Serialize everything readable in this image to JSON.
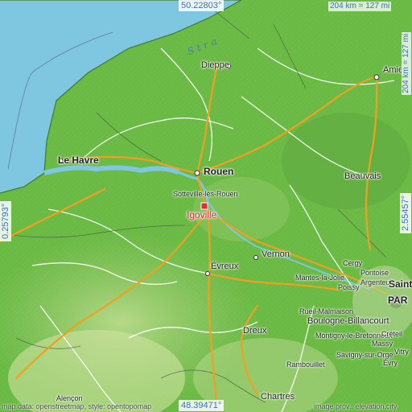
{
  "coordinates": {
    "top": "50.22803°",
    "bottom": "48.39471°",
    "left": "0.25793°",
    "right": "2.55457°"
  },
  "scale": {
    "top": "204 km = 127 mi",
    "right": "204 km = 127 mi"
  },
  "water_label": "Stra",
  "highlight_town": "Igoville",
  "places": [
    {
      "name": "Dieppe",
      "type": "city"
    },
    {
      "name": "Amie",
      "type": "city"
    },
    {
      "name": "Le Havre",
      "type": "big"
    },
    {
      "name": "Rouen",
      "type": "big"
    },
    {
      "name": "Sotteville-lès-Rouen",
      "type": "small"
    },
    {
      "name": "Beauvais",
      "type": "city"
    },
    {
      "name": "Vernon",
      "type": "city"
    },
    {
      "name": "Évreux",
      "type": "city"
    },
    {
      "name": "Cergy",
      "type": "small"
    },
    {
      "name": "Pontoise",
      "type": "small"
    },
    {
      "name": "Mantes-la-Jolie",
      "type": "small"
    },
    {
      "name": "Argenteuil",
      "type": "small"
    },
    {
      "name": "Poissy",
      "type": "small"
    },
    {
      "name": "Saint",
      "type": "big"
    },
    {
      "name": "PAR",
      "type": "big"
    },
    {
      "name": "Rueil-Malmaison",
      "type": "small"
    },
    {
      "name": "Boulogne-Billancourt",
      "type": "city"
    },
    {
      "name": "Dreux",
      "type": "city"
    },
    {
      "name": "Montigny-le-Bretonneux",
      "type": "small"
    },
    {
      "name": "Massy",
      "type": "small"
    },
    {
      "name": "Savigny-sur-Orge",
      "type": "small"
    },
    {
      "name": "Rambouillet",
      "type": "small"
    },
    {
      "name": "Évry",
      "type": "small"
    },
    {
      "name": "Chartres",
      "type": "city"
    },
    {
      "name": "Alençon",
      "type": "small"
    },
    {
      "name": "Créteil",
      "type": "small"
    },
    {
      "name": "Vitry",
      "type": "small"
    }
  ],
  "credits": {
    "left": "map data: openstreetmap, style: opentopomap",
    "right": "image prov.: elevation.city"
  },
  "colors": {
    "sea": "#7fc6e0",
    "land_low": "#74c04c",
    "land_mid": "#5aab3c",
    "plain": "#b9d98c",
    "road_major": "#f0a020",
    "road_minor": "#ffffff",
    "highlight": "#e8283c",
    "coord_text": "#3a6fc4"
  }
}
